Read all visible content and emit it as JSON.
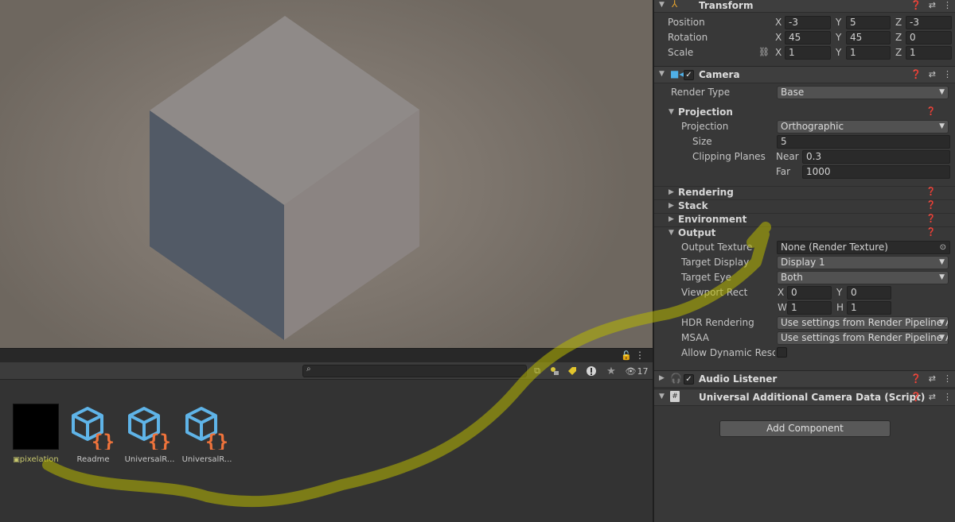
{
  "colors": {
    "cube_top": "#8f8a88",
    "cube_left": "#525a66",
    "cube_right": "#8b8482",
    "annotation": "#b8b800",
    "highlight_text": "#d9d42a"
  },
  "project": {
    "hidden_count": "17",
    "assets": [
      {
        "label": "pixelation",
        "icon": "render-texture-icon"
      },
      {
        "label": "Readme",
        "icon": "script-asset-icon"
      },
      {
        "label": "UniversalR...",
        "icon": "script-asset-icon"
      },
      {
        "label": "UniversalR...",
        "icon": "script-asset-icon"
      }
    ]
  },
  "inspector": {
    "transform": {
      "title": "Transform",
      "position_label": "Position",
      "rotation_label": "Rotation",
      "scale_label": "Scale",
      "x": "X",
      "y": "Y",
      "z": "Z",
      "position": {
        "x": "-3",
        "y": "5",
        "z": "-3"
      },
      "rotation": {
        "x": "45",
        "y": "45",
        "z": "0"
      },
      "scale": {
        "x": "1",
        "y": "1",
        "z": "1"
      }
    },
    "camera": {
      "title": "Camera",
      "render_type_label": "Render Type",
      "render_type": "Base",
      "projection_section": "Projection",
      "projection_label": "Projection",
      "projection": "Orthographic",
      "size_label": "Size",
      "size": "5",
      "clipping_label": "Clipping Planes",
      "near_label": "Near",
      "near": "0.3",
      "far_label": "Far",
      "far": "1000",
      "rendering_section": "Rendering",
      "stack_section": "Stack",
      "environment_section": "Environment",
      "output_section": "Output",
      "output_texture_label": "Output Texture",
      "output_texture": "None (Render Texture)",
      "target_display_label": "Target Display",
      "target_display": "Display 1",
      "target_eye_label": "Target Eye",
      "target_eye": "Both",
      "viewport_rect_label": "Viewport Rect",
      "vp_x_label": "X",
      "vp_x": "0",
      "vp_y_label": "Y",
      "vp_y": "0",
      "vp_w_label": "W",
      "vp_w": "1",
      "vp_h_label": "H",
      "vp_h": "1",
      "hdr_label": "HDR Rendering",
      "hdr": "Use settings from Render Pipeline As",
      "msaa_label": "MSAA",
      "msaa": "Use settings from Render Pipeline As",
      "dynamic_res_label": "Allow Dynamic Resolu"
    },
    "audio_listener": {
      "title": "Audio Listener"
    },
    "urp_data": {
      "title": "Universal Additional Camera Data (Script)"
    },
    "add_component": "Add Component"
  }
}
